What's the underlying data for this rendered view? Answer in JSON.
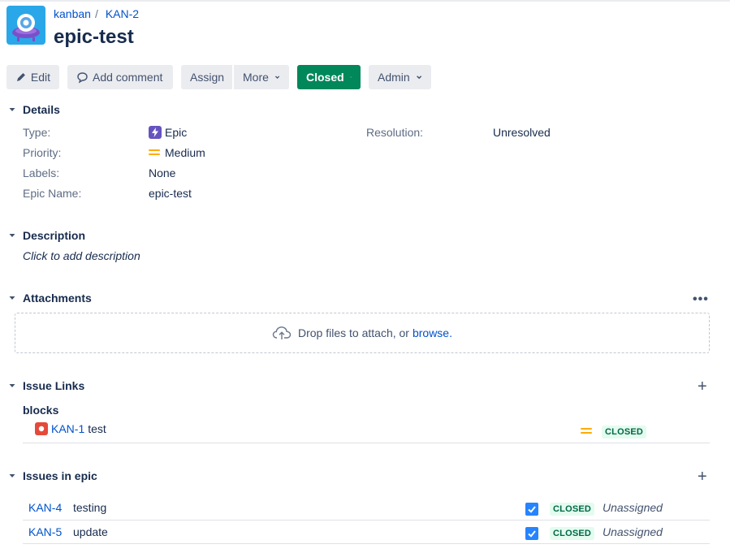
{
  "breadcrumb": {
    "project": "kanban",
    "issue_key": "KAN-2"
  },
  "issue": {
    "title": "epic-test"
  },
  "toolbar": {
    "edit": "Edit",
    "add_comment": "Add comment",
    "assign": "Assign",
    "more": "More",
    "status": "Closed",
    "admin": "Admin"
  },
  "details": {
    "heading": "Details",
    "type_label": "Type:",
    "type_value": "Epic",
    "priority_label": "Priority:",
    "priority_value": "Medium",
    "labels_label": "Labels:",
    "labels_value": "None",
    "epic_name_label": "Epic Name:",
    "epic_name_value": "epic-test",
    "resolution_label": "Resolution:",
    "resolution_value": "Unresolved"
  },
  "description": {
    "heading": "Description",
    "placeholder": "Click to add description"
  },
  "attachments": {
    "heading": "Attachments",
    "more": "•••",
    "drop_text": "Drop files to attach, or",
    "browse": "browse."
  },
  "issue_links": {
    "heading": "Issue Links",
    "group": "blocks",
    "items": [
      {
        "key": "KAN-1",
        "summary": "test",
        "status": "CLOSED"
      }
    ]
  },
  "issues_in_epic": {
    "heading": "Issues in epic",
    "items": [
      {
        "key": "KAN-4",
        "summary": "testing",
        "status": "CLOSED",
        "assignee": "Unassigned"
      },
      {
        "key": "KAN-5",
        "summary": "update",
        "status": "CLOSED",
        "assignee": "Unassigned"
      }
    ]
  },
  "colors": {
    "closed_green": "#00875a",
    "link_blue": "#0052cc",
    "epic_purple": "#6554c0",
    "bug_red": "#e5493a",
    "priority_medium": "#ffab00"
  }
}
